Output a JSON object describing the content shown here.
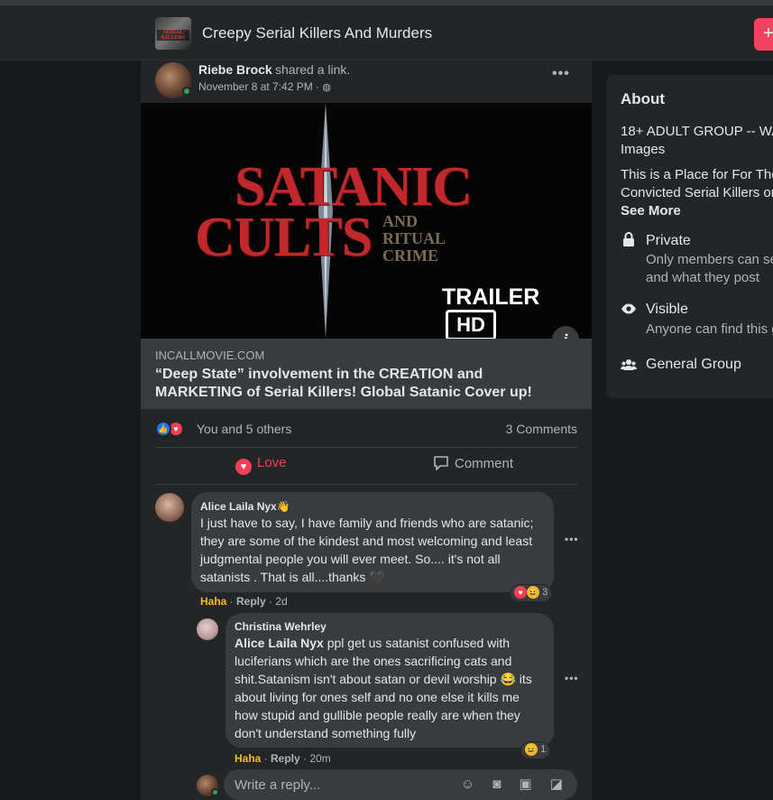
{
  "group": {
    "title": "Creepy Serial Killers And Murders",
    "thumb_text": "SERIAL KILLERS",
    "join_glyph": "+"
  },
  "post": {
    "author": "Riebe Brock",
    "action": "shared a link.",
    "time": "November 8 at 7:42 PM ·",
    "privacy_icon": "globe-icon",
    "image": {
      "title_line1": "SATANIC",
      "title_line2": "CULTS",
      "subtitle": "AND RITUAL CRIME",
      "trailer": "TRAILER",
      "hd": "HD"
    },
    "link_domain": "INCALLMOVIE.COM",
    "link_title": "“Deep State” involvement in the CREATION and MARKETING of Serial Killers! Global Satanic Cover up!",
    "reactions_text": "You and 5 others",
    "comments_count": "3 Comments",
    "love_label": "Love",
    "comment_label": "Comment"
  },
  "comments": [
    {
      "name": "Alice Laila Nyx",
      "name_emoji": "👋",
      "text": "I just have to say, I have family and friends who are satanic; they are some of the kindest and most welcoming and least judgmental people you will ever meet. So.... it's not all satanists . That is all....thanks 🖤",
      "reaction_label": "Haha",
      "reply_label": "Reply",
      "age": "2d",
      "reaction_count": "3"
    },
    {
      "name": "Christina Wehrley",
      "mention": "Alice Laila Nyx",
      "text": "ppl get us satanist confused with luciferians which are the ones sacrificing cats and shit.Satanism isn't about satan or devil worship 😂 its about living for ones self and no one else it kills me how stupid and gullible people really are when they don't understand something fully",
      "reaction_label": "Haha",
      "reply_label": "Reply",
      "age": "20m",
      "reaction_count": "1"
    }
  ],
  "reply_box": {
    "placeholder": "Write a reply...",
    "tools": "☺ ◙ ▣ ◪"
  },
  "about": {
    "title": "About",
    "desc_line1": "18+ ADULT GROUP -- WA",
    "desc_line2": "Images",
    "desc_line3": "This is a Place for For Tho",
    "desc_line4": "Convicted Serial Killers or",
    "see_more": "See More",
    "private_title": "Private",
    "private_sub1": "Only members can se",
    "private_sub2": "and what they post",
    "visible_title": "Visible",
    "visible_sub": "Anyone can find this g",
    "general_title": "General Group"
  },
  "colors": {
    "background": "#18191a",
    "card": "#242526",
    "accent_love": "#f33e58",
    "haha": "#f7b928"
  }
}
